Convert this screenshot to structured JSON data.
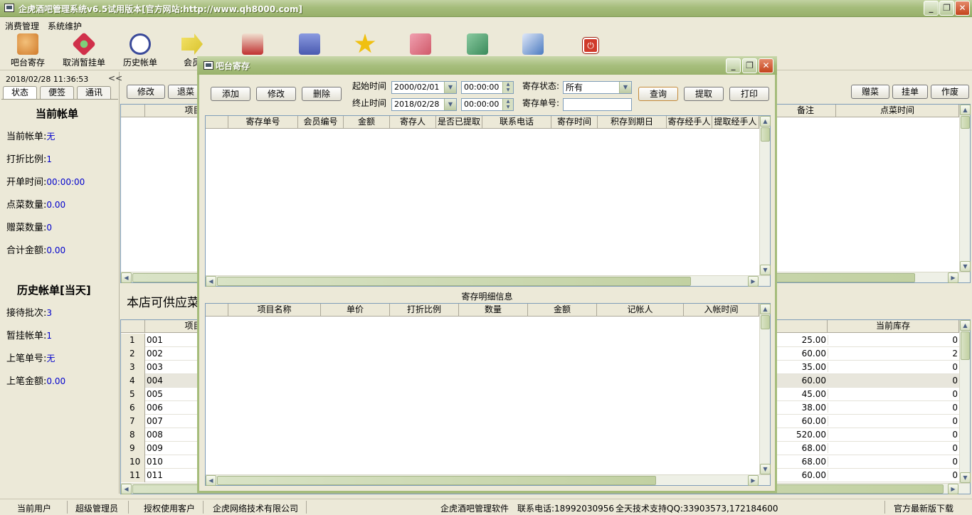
{
  "window": {
    "title": "企虎酒吧管理系统v6.5试用版本[官方网站:http://www.qh8000.com]",
    "min": "_",
    "max": "❐",
    "close": "✕"
  },
  "menu": [
    "消费管理",
    "系统维护"
  ],
  "toolbar": [
    {
      "label": "吧台寄存",
      "icon": "storage-cabinet-icon",
      "color": "#d07a2a"
    },
    {
      "label": "取消暂挂单",
      "icon": "cancel-hold-icon",
      "color": "#d0304a"
    },
    {
      "label": "历史帐单",
      "icon": "alarm-clock-icon",
      "color": "#3a4a9a"
    },
    {
      "label": "会员",
      "icon": "member-arrow-icon",
      "color": "#d8c22a"
    },
    {
      "label": "",
      "icon": "person-icon",
      "color": "#c03030"
    },
    {
      "label": "",
      "icon": "face-icon",
      "color": "#4a5ab0"
    },
    {
      "label": "",
      "icon": "star-icon",
      "color": "#f0c010"
    },
    {
      "label": "",
      "icon": "calculator-icon",
      "color": "#d05a6a"
    },
    {
      "label": "",
      "icon": "book-icon",
      "color": "#3a8a5a"
    },
    {
      "label": "",
      "icon": "handshake-icon",
      "color": "#4a7ac0"
    },
    {
      "label": "",
      "icon": "power-icon",
      "color": "#d03a2a"
    }
  ],
  "left": {
    "datetime": "2018/02/28 11:36:53",
    "collapse": "<<",
    "tabs": [
      "状态",
      "便签",
      "通讯"
    ],
    "current_title": "当前帐单",
    "current": [
      {
        "label": "当前帐单:",
        "value": "无"
      },
      {
        "label": "打折比例:",
        "value": "1"
      },
      {
        "label": "开单时间:",
        "value": "00:00:00"
      },
      {
        "label": "点菜数量:",
        "value": "0.00"
      },
      {
        "label": "赠菜数量:",
        "value": "0"
      },
      {
        "label": "合计金额:",
        "value": "0.00"
      }
    ],
    "history_title": "历史帐单[当天]",
    "history": [
      {
        "label": "接待批次:",
        "value": "3"
      },
      {
        "label": "暂挂帐单:",
        "value": "1"
      },
      {
        "label": "上笔单号:",
        "value": "无"
      },
      {
        "label": "上笔金额:",
        "value": "0.00"
      }
    ]
  },
  "main": {
    "buttons_left": [
      "修改",
      "退菜"
    ],
    "buttons_right": [
      "赠菜",
      "挂单",
      "作废"
    ],
    "order_headers": {
      "item_code": "项目编码",
      "note": "备注",
      "order_time": "点菜时间"
    },
    "supply_label": "本店可供应菜",
    "stock_headers": {
      "item_code": "项目编码",
      "stock": "当前库存"
    },
    "stock_rows": [
      {
        "n": "1",
        "code": "001",
        "price": "25.00",
        "stock": "0"
      },
      {
        "n": "2",
        "code": "002",
        "price": "60.00",
        "stock": "2"
      },
      {
        "n": "3",
        "code": "003",
        "price": "35.00",
        "stock": "0"
      },
      {
        "n": "4",
        "code": "004",
        "price": "60.00",
        "stock": "0"
      },
      {
        "n": "5",
        "code": "005",
        "price": "45.00",
        "stock": "0"
      },
      {
        "n": "6",
        "code": "006",
        "price": "38.00",
        "stock": "0"
      },
      {
        "n": "7",
        "code": "007",
        "price": "60.00",
        "stock": "0"
      },
      {
        "n": "8",
        "code": "008",
        "price": "520.00",
        "stock": "0"
      },
      {
        "n": "9",
        "code": "009",
        "price": "68.00",
        "stock": "0"
      },
      {
        "n": "10",
        "code": "010",
        "price": "68.00",
        "stock": "0"
      },
      {
        "n": "11",
        "code": "011",
        "price": "60.00",
        "stock": "0"
      }
    ]
  },
  "dialog": {
    "title": "吧台寄存",
    "btn_add": "添加",
    "btn_edit": "修改",
    "btn_delete": "删除",
    "start_label": "起始时间",
    "end_label": "终止时间",
    "start_date": "2000/02/01",
    "end_date": "2018/02/28",
    "start_time": "00:00:00",
    "end_time": "00:00:00",
    "status_label": "寄存状态:",
    "status_value": "所有",
    "no_label": "寄存单号:",
    "no_value": "",
    "btn_query": "查询",
    "btn_take": "提取",
    "btn_print": "打印",
    "cols": [
      "寄存单号",
      "会员编号",
      "金额",
      "寄存人",
      "是否已提取",
      "联系电话",
      "寄存时间",
      "积存到期日",
      "寄存经手人",
      "提取经手人"
    ],
    "detail_title": "寄存明细信息",
    "detail_cols": [
      "项目名称",
      "单价",
      "打折比例",
      "数量",
      "金额",
      "记帐人",
      "入帐时间"
    ]
  },
  "status": [
    "当前用户",
    "超级管理员",
    "授权使用客户",
    "企虎网络技术有限公司",
    "企虎酒吧管理软件",
    "联系电话:18992030956",
    "全天技术支持QQ:33903573,172184600",
    "官方最新版下载"
  ]
}
